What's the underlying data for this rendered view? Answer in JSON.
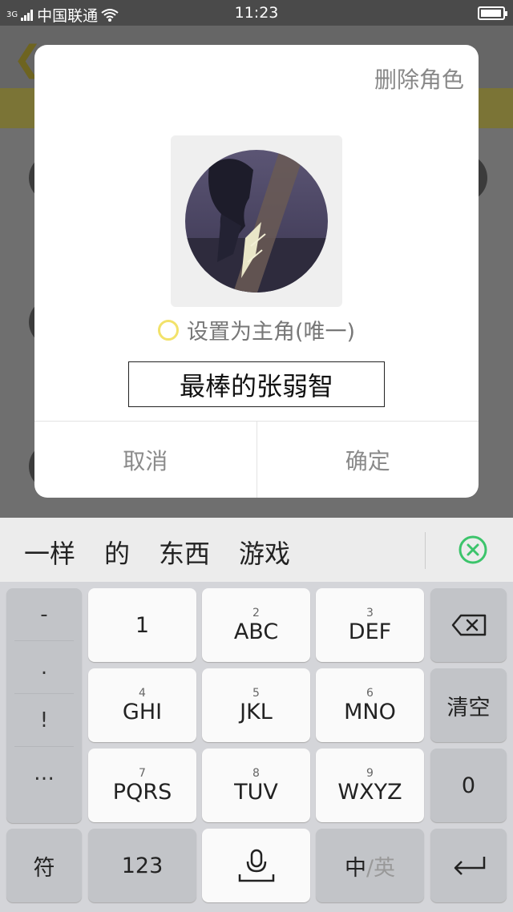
{
  "status_bar": {
    "network_type": "3G",
    "carrier": "中国联通",
    "time": "11:23",
    "battery_level": 0.95
  },
  "dialog": {
    "delete_label": "删除角色",
    "main_role_label": "设置为主角(唯一)",
    "name_value": "最棒的张弱智",
    "cancel_label": "取消",
    "confirm_label": "确定"
  },
  "candidate_bar": {
    "words": [
      "一样",
      "的",
      "东西",
      "游戏"
    ]
  },
  "keyboard": {
    "punctuation": [
      "-",
      ".",
      "!",
      "…"
    ],
    "rows": [
      [
        {
          "num": "",
          "label": "1"
        },
        {
          "num": "2",
          "label": "ABC"
        },
        {
          "num": "3",
          "label": "DEF"
        }
      ],
      [
        {
          "num": "4",
          "label": "GHI"
        },
        {
          "num": "5",
          "label": "JKL"
        },
        {
          "num": "6",
          "label": "MNO"
        }
      ],
      [
        {
          "num": "7",
          "label": "PQRS"
        },
        {
          "num": "8",
          "label": "TUV"
        },
        {
          "num": "9",
          "label": "WXYZ"
        }
      ]
    ],
    "clear_label": "清空",
    "zero_label": "0",
    "symbol_label": "符",
    "num_switch_label": "123",
    "lang_zh": "中",
    "lang_en": "/英",
    "accent_colors": {
      "radio": "#f2e26a",
      "close": "#3cc46b"
    }
  }
}
